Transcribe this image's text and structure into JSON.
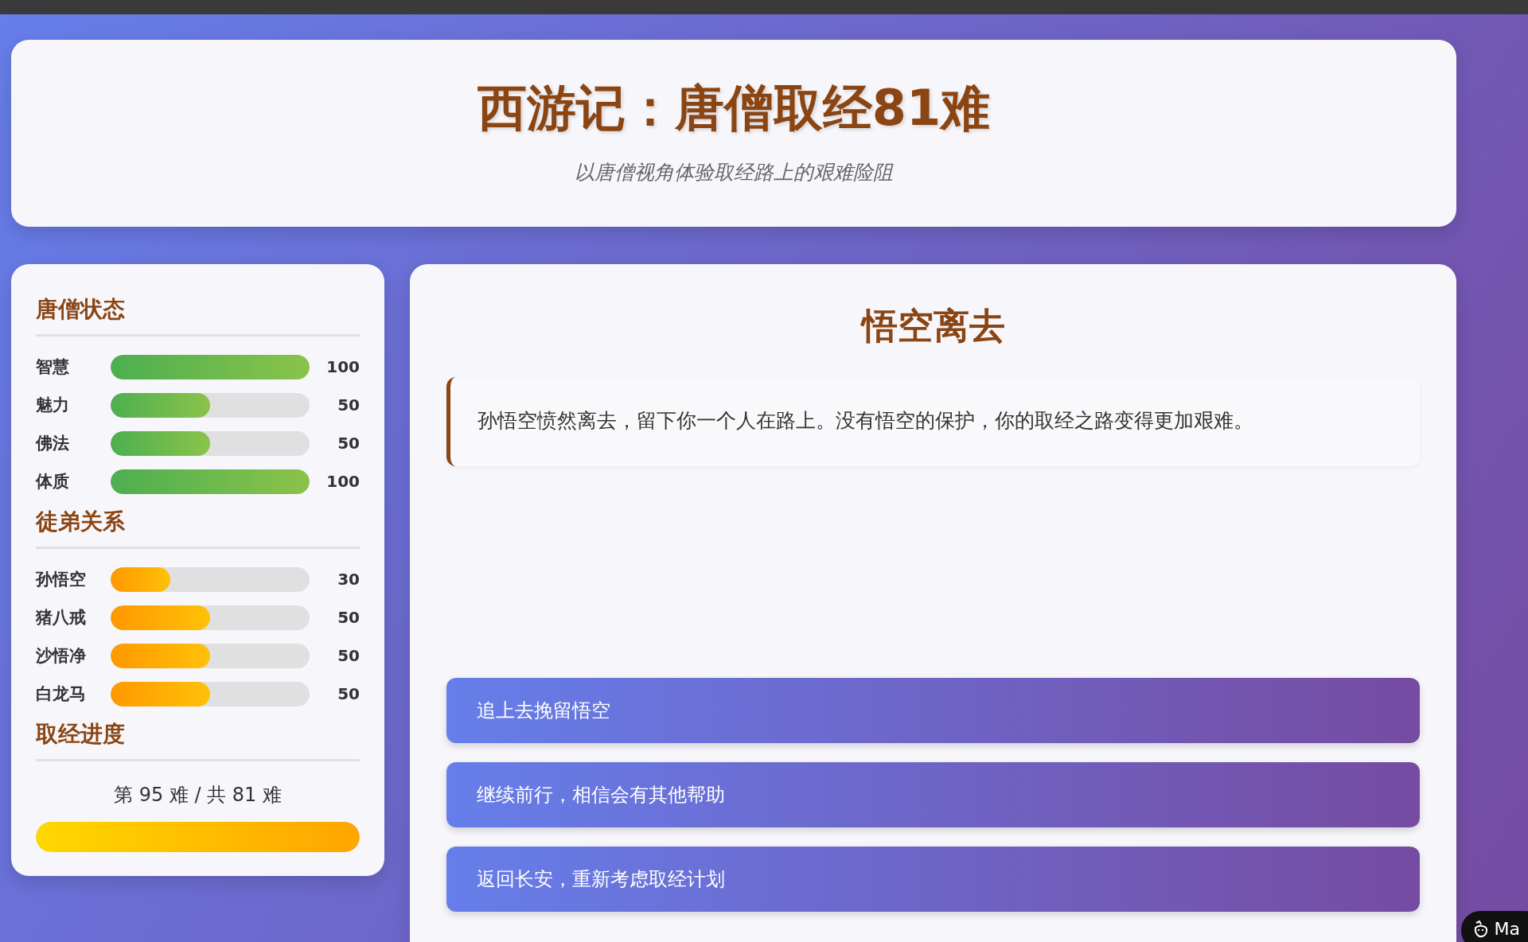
{
  "header": {
    "title": "西游记：唐僧取经81难",
    "subtitle": "以唐僧视角体验取经路上的艰难险阻"
  },
  "sidebar": {
    "sections": [
      {
        "title": "唐僧状态",
        "kind": "stat",
        "items": [
          {
            "label": "智慧",
            "level": 1,
            "value": "100"
          },
          {
            "label": "魅力",
            "level": 0.5,
            "value": "50"
          },
          {
            "label": "佛法",
            "level": 0.5,
            "value": "50"
          },
          {
            "label": "体质",
            "level": 1,
            "value": "100"
          }
        ]
      },
      {
        "title": "徒弟关系",
        "kind": "relation",
        "items": [
          {
            "label": "孙悟空",
            "level": 0.3,
            "value": "30"
          },
          {
            "label": "猪八戒",
            "level": 0.5,
            "value": "50"
          },
          {
            "label": "沙悟净",
            "level": 0.5,
            "value": "50"
          },
          {
            "label": "白龙马",
            "level": 0.5,
            "value": "50"
          }
        ]
      },
      {
        "title": "取经进度",
        "kind": "progress",
        "text": "第 95 难 / 共 81 难",
        "level": 1
      }
    ]
  },
  "scene": {
    "title": "悟空离去",
    "description": "孙悟空愤然离去，留下你一个人在路上。没有悟空的保护，你的取经之路变得更加艰难。",
    "choices": [
      "追上去挽留悟空",
      "继续前行，相信会有其他帮助",
      "返回长安，重新考虑取经计划"
    ]
  },
  "corner_badge": {
    "label": "Ma"
  }
}
